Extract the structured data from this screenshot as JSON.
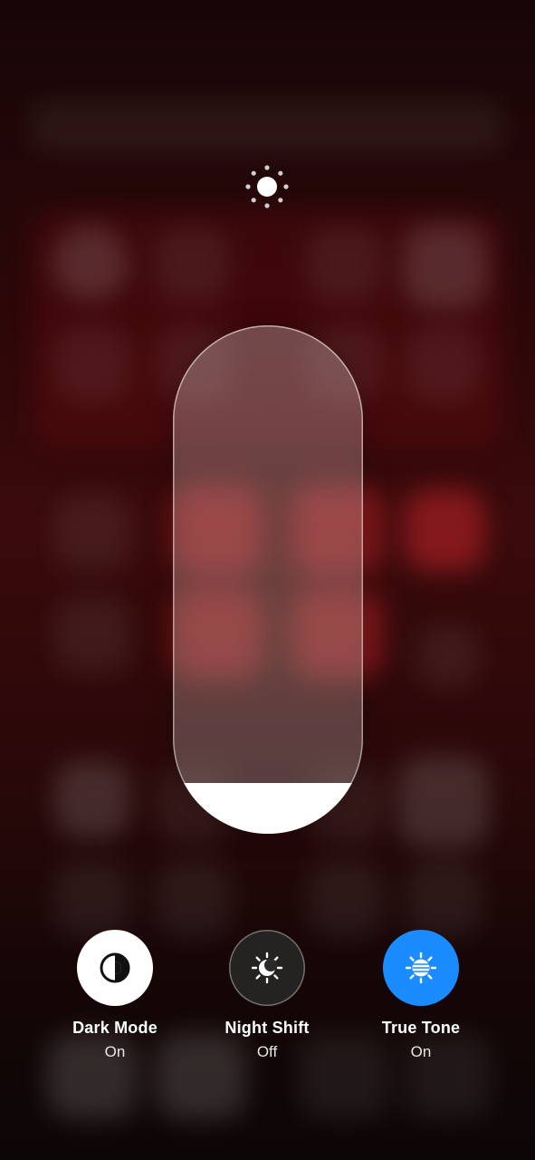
{
  "brightness": {
    "level": 0.1,
    "icon": "sun-icon"
  },
  "toggles": [
    {
      "label": "Dark Mode",
      "state": "On",
      "icon": "dark-mode-icon",
      "color": "#ffffff"
    },
    {
      "label": "Night Shift",
      "state": "Off",
      "icon": "night-shift-icon",
      "color": "#282828"
    },
    {
      "label": "True Tone",
      "state": "On",
      "icon": "true-tone-icon",
      "color": "#1a8cff"
    }
  ]
}
